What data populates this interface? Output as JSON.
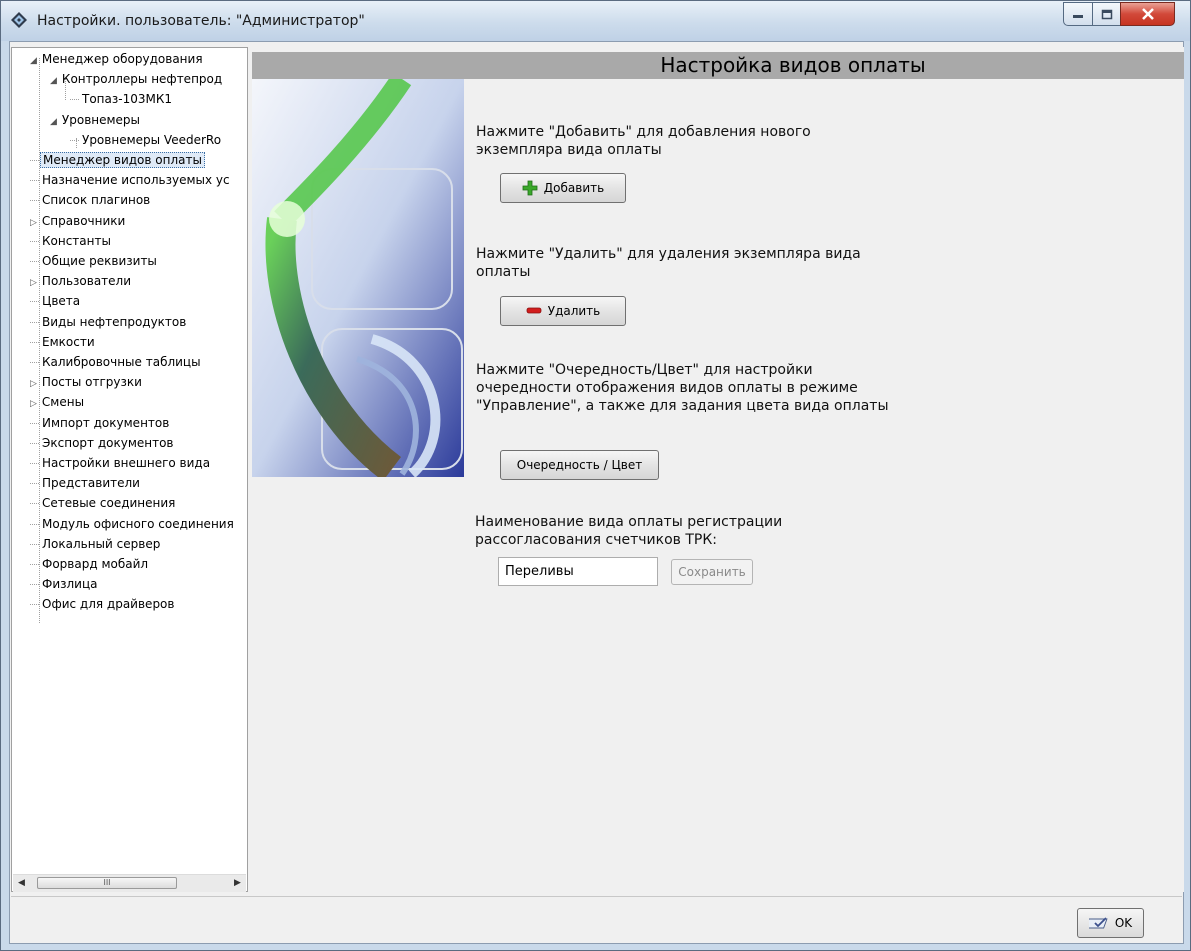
{
  "window": {
    "title": "Настройки. пользователь: \"Администратор\"",
    "buttons": {
      "minimize": "minimize-icon",
      "maximize": "maximize-icon",
      "close": "close-icon"
    }
  },
  "tree": {
    "items": [
      {
        "label": "Менеджер оборудования",
        "expander": "◢"
      },
      {
        "label": "Контроллеры нефтепрод",
        "expander": "◢"
      },
      {
        "label": "Топаз-103МК1"
      },
      {
        "label": "Уровнемеры",
        "expander": "◢"
      },
      {
        "label": "Уровнемеры VeederRo"
      },
      {
        "label": "Менеджер видов оплаты"
      },
      {
        "label": "Назначение используемых ус"
      },
      {
        "label": "Список плагинов"
      },
      {
        "label": "Справочники",
        "expander": "▷"
      },
      {
        "label": "Константы"
      },
      {
        "label": "Общие реквизиты"
      },
      {
        "label": "Пользователи",
        "expander": "▷"
      },
      {
        "label": "Цвета"
      },
      {
        "label": "Виды нефтепродуктов"
      },
      {
        "label": "Емкости"
      },
      {
        "label": "Калибровочные таблицы"
      },
      {
        "label": "Посты отгрузки",
        "expander": "▷"
      },
      {
        "label": "Смены",
        "expander": "▷"
      },
      {
        "label": "Импорт документов"
      },
      {
        "label": "Экспорт документов"
      },
      {
        "label": "Настройки внешнего вида"
      },
      {
        "label": "Представители"
      },
      {
        "label": "Сетевые соединения"
      },
      {
        "label": "Модуль офисного соединения"
      },
      {
        "label": "Локальный сервер"
      },
      {
        "label": "Форвард мобайл"
      },
      {
        "label": "Физлица"
      },
      {
        "label": "Офис для драйверов"
      }
    ],
    "scrollbar_thumb": "III"
  },
  "main": {
    "header": "Настройка видов оплаты",
    "add_text": "Нажмите \"Добавить\" для добавления нового экземпляра вида оплаты",
    "add_button": "Добавить",
    "delete_text": "Нажмите \"Удалить\" для удаления экземпляра вида оплаты",
    "delete_button": "Удалить",
    "order_text": "Нажмите \"Очередность/Цвет\" для настройки очередности отображения видов оплаты в режиме \"Управление\", а также для задания цвета вида оплаты",
    "order_button": "Очередность / Цвет",
    "mismatch_label": "Наименование вида оплаты регистрации рассогласования счетчиков ТРК:",
    "mismatch_value": "Переливы",
    "save_button": "Сохранить"
  },
  "footer": {
    "ok_button": "OK"
  },
  "colors": {
    "header_bg": "#a9a9a9",
    "selection_bg": "#dfeaf7",
    "add_icon": "#3aa82a",
    "delete_icon": "#d21d1d"
  }
}
